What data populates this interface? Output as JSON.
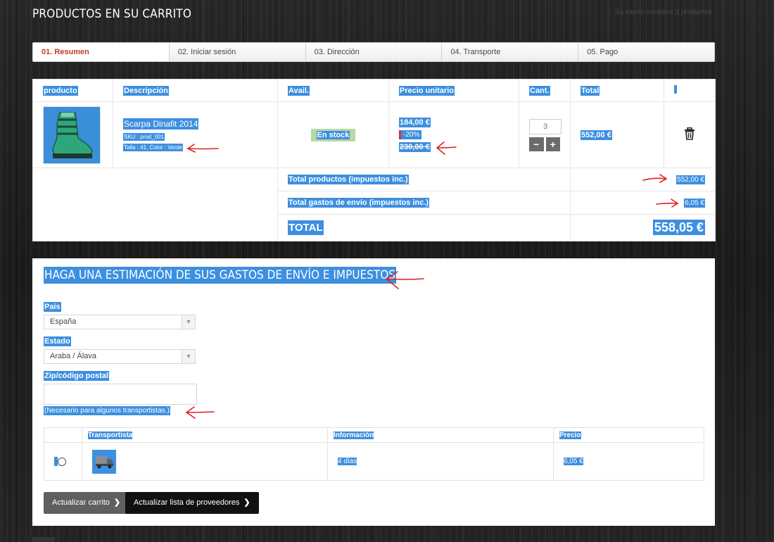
{
  "header": {
    "title": "PRODUCTOS EN SU CARRITO",
    "right_text": "Su carrito contiene 3 productos"
  },
  "steps": [
    {
      "label": "01. Resumen",
      "active": true
    },
    {
      "label": "02. Iniciar sesión"
    },
    {
      "label": "03. Dirección"
    },
    {
      "label": "04. Transporte"
    },
    {
      "label": "05. Pago"
    }
  ],
  "cart": {
    "columns": {
      "product": "producto",
      "description": "Descripción",
      "avail": "Avail.",
      "unit_price": "Precio unitario",
      "qty": "Cant.",
      "total": "Total"
    },
    "item": {
      "name": "Scarpa Dinafit 2014",
      "sku": "SKU : prod_001",
      "attributes": "Talla : 41, Color : Verde",
      "availability": "En stock",
      "price": "184,00 €",
      "discount": "-20%",
      "old_price": "230,00 €",
      "quantity": "3",
      "line_total": "552,00 €",
      "minus": "−",
      "plus": "+"
    },
    "summary": {
      "products_label": "Total productos (impuestos inc.)",
      "products_value": "552,00 €",
      "shipping_label": "Total gastos de envío (impuestos inc.)",
      "shipping_value": "6,05 €",
      "total_label": "TOTAL",
      "total_value": "558,05 €"
    }
  },
  "estimate": {
    "title": "HAGA UNA ESTIMACIÓN DE SUS GASTOS DE ENVÍO E IMPUESTOS",
    "country_label": "País",
    "country_value": "España",
    "state_label": "Estado",
    "state_value": "Araba / Álava",
    "zip_label": "Zip/código postal",
    "zip_value": "",
    "zip_hint": "(Necesario para algunos transportistas.)",
    "carriers": {
      "col_carrier": "Transportista",
      "col_info": "Información",
      "col_price": "Precio",
      "rows": [
        {
          "info": "4 días",
          "price": "6,05 €"
        }
      ]
    },
    "update_cart_label": "Actualizar carrito",
    "update_carriers_label": "Actualizar lista de proveedores"
  },
  "colors": {
    "highlight": "#3d8fe0",
    "active_step": "#c0392b",
    "annotation": "#e02020"
  },
  "icons": [
    "trash-icon",
    "chevron-right-icon",
    "truck-icon",
    "boot-image"
  ]
}
